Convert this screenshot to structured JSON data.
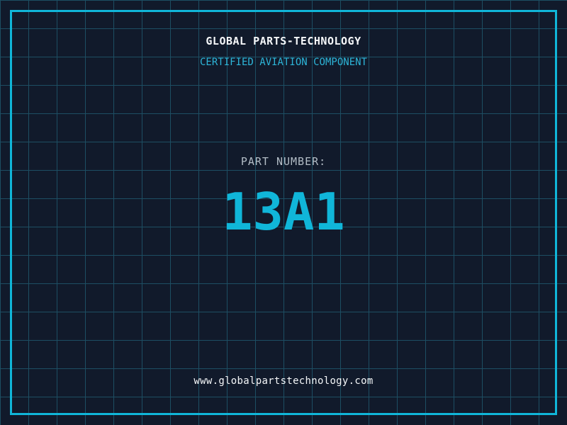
{
  "header": {
    "company_name": "GLOBAL PARTS-TECHNOLOGY",
    "tagline": "CERTIFIED AVIATION COMPONENT"
  },
  "part": {
    "label": "PART NUMBER:",
    "number": "13A1"
  },
  "footer": {
    "website": "www.globalpartstechnology.com"
  },
  "colors": {
    "background": "#111a2b",
    "grid_line": "#1d4e63",
    "accent": "#10b6d9",
    "subtitle_cyan": "#2db5d8",
    "label_gray": "#b3bdc6",
    "text_white": "#f5f7f9"
  }
}
